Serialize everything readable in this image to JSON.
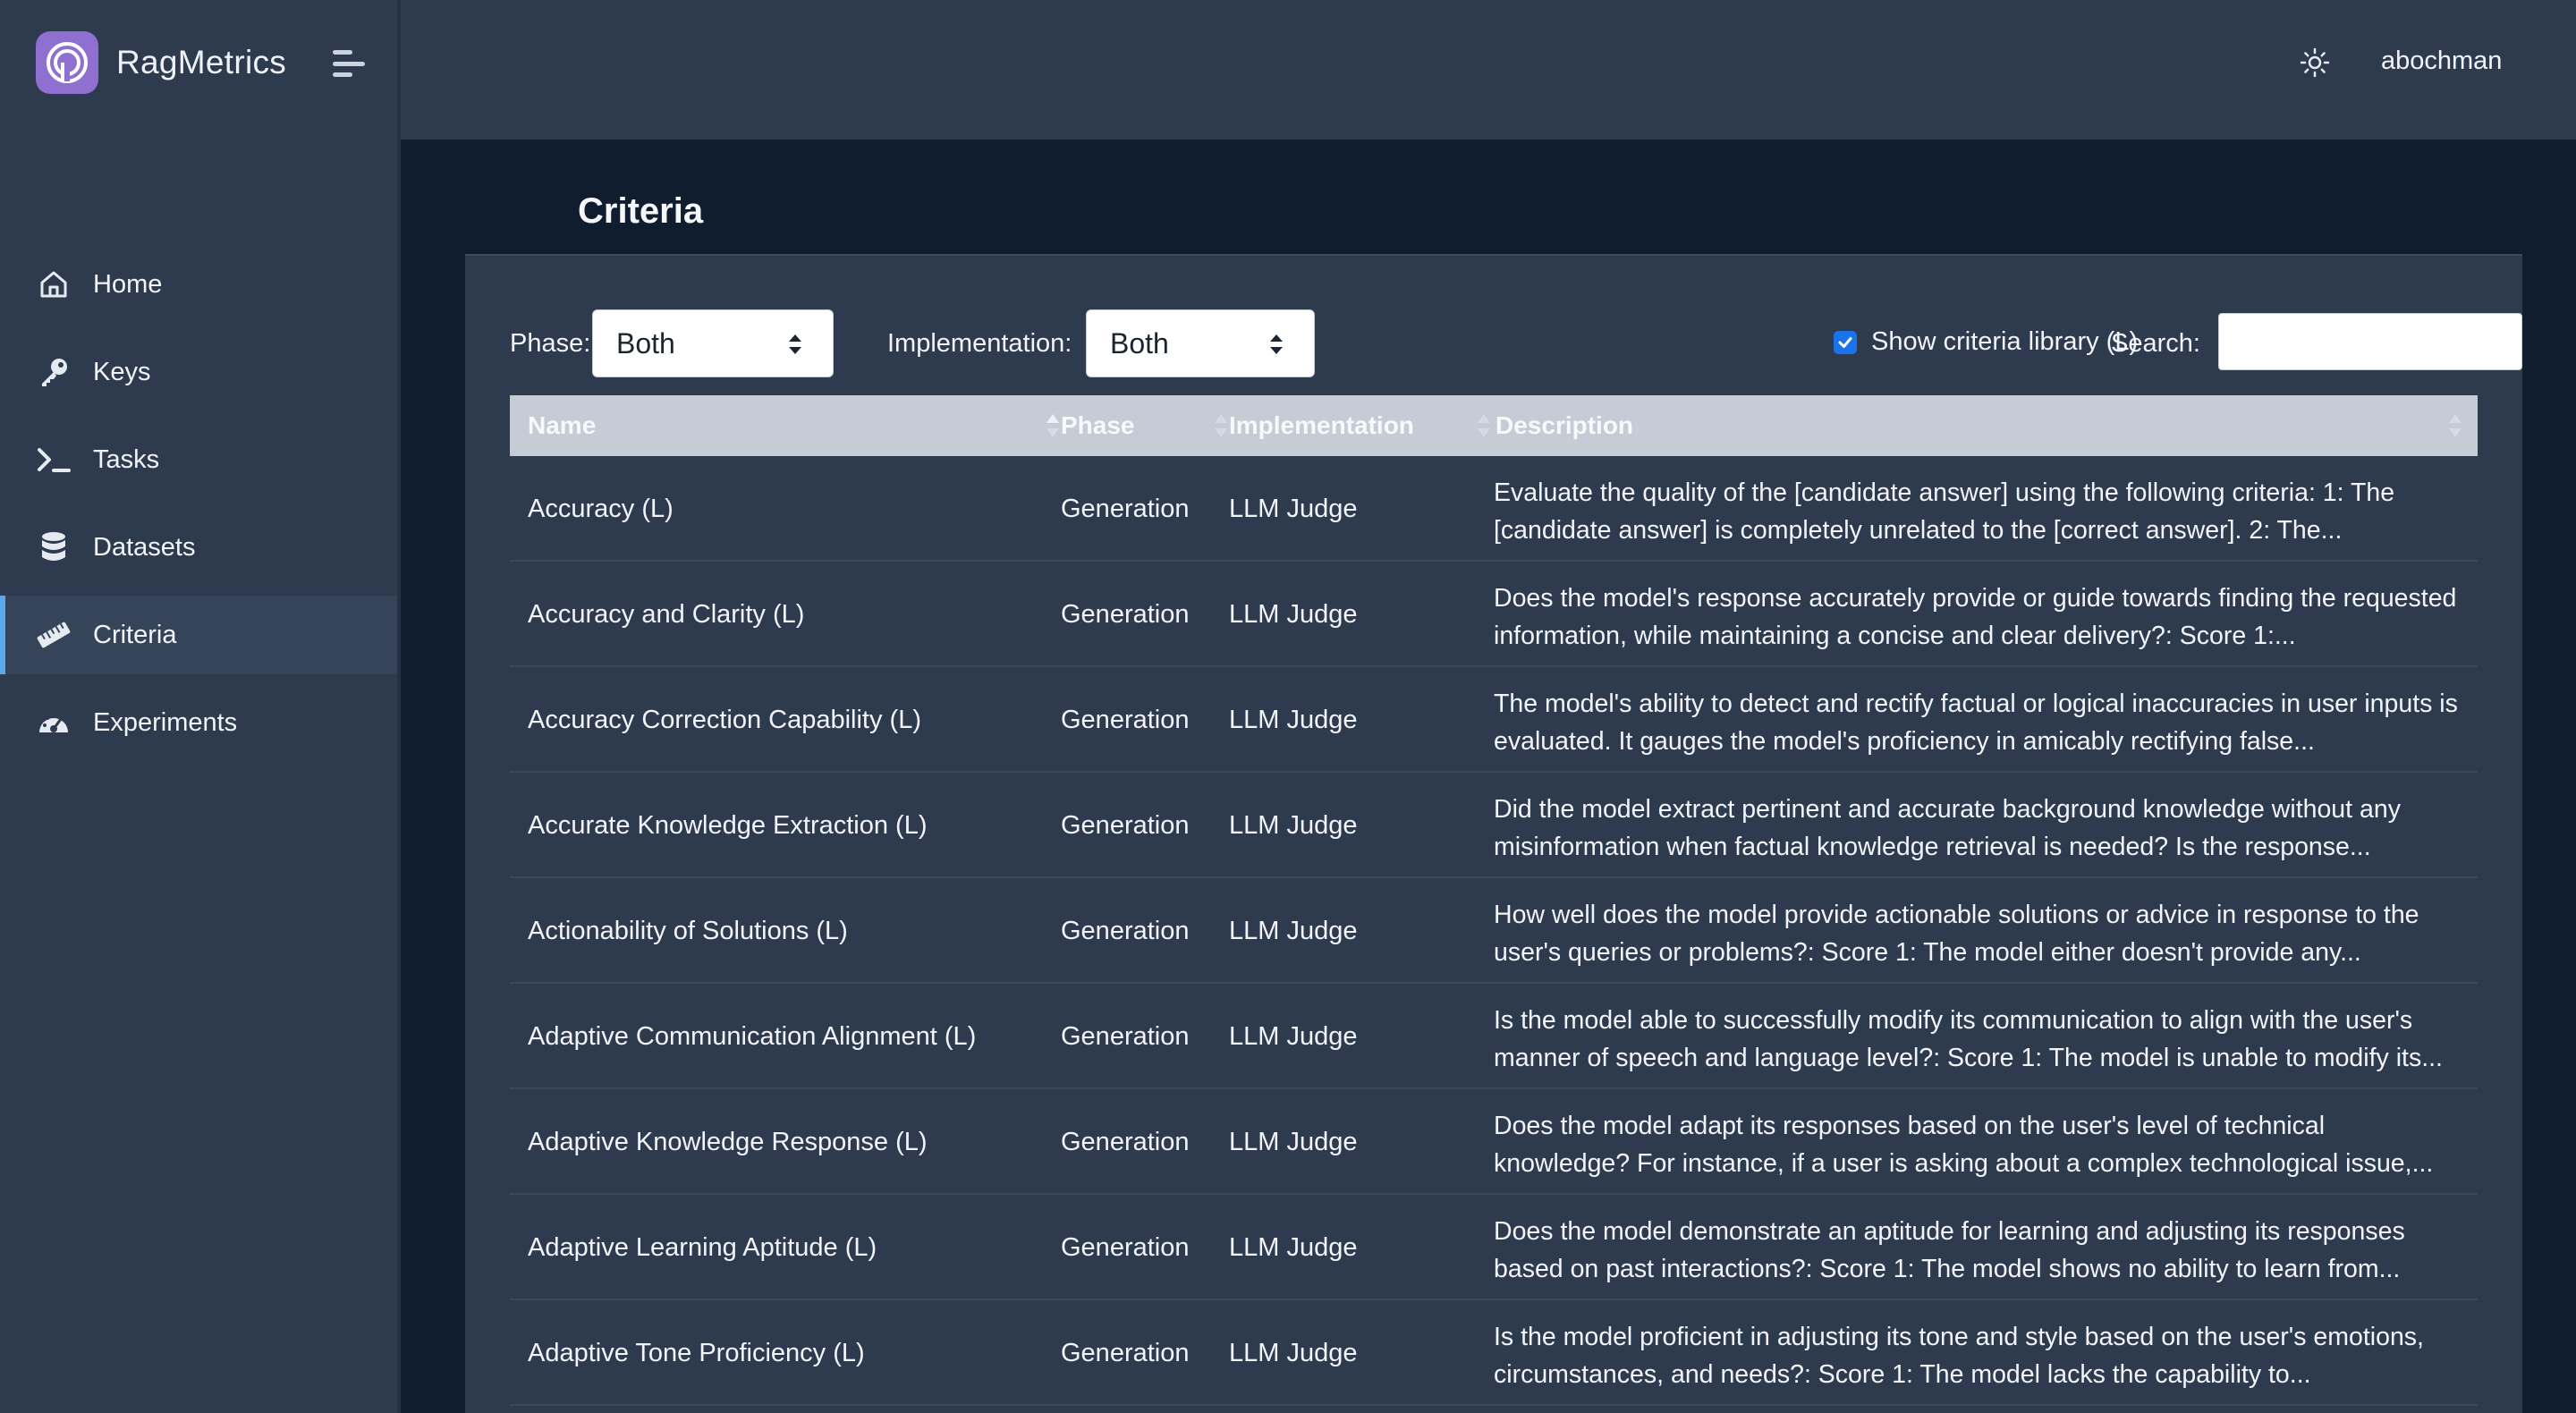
{
  "app": {
    "brand": "RagMetrics"
  },
  "header": {
    "username": "abochman"
  },
  "sidebar": {
    "items": [
      {
        "label": "Home",
        "icon": "home-icon",
        "active": false
      },
      {
        "label": "Keys",
        "icon": "key-icon",
        "active": false
      },
      {
        "label": "Tasks",
        "icon": "terminal-icon",
        "active": false
      },
      {
        "label": "Datasets",
        "icon": "database-icon",
        "active": false
      },
      {
        "label": "Criteria",
        "icon": "ruler-icon",
        "active": true
      },
      {
        "label": "Experiments",
        "icon": "gauge-icon",
        "active": false
      }
    ]
  },
  "page": {
    "title": "Criteria"
  },
  "filters": {
    "phase_label": "Phase:",
    "phase_value": "Both",
    "implementation_label": "Implementation:",
    "implementation_value": "Both",
    "library_label": "Show criteria library (L)",
    "library_checked": true,
    "search_label": "Search:",
    "search_value": ""
  },
  "table": {
    "columns": [
      "Name",
      "Phase",
      "Implementation",
      "Description"
    ],
    "rows": [
      {
        "name": "Accuracy (L)",
        "phase": "Generation",
        "implementation": "LLM Judge",
        "description": "Evaluate the quality of the [candidate answer] using the following criteria: 1: The [candidate answer] is completely unrelated to the [correct answer]. 2: The..."
      },
      {
        "name": "Accuracy and Clarity (L)",
        "phase": "Generation",
        "implementation": "LLM Judge",
        "description": "Does the model's response accurately provide or guide towards finding the requested information, while maintaining a concise and clear delivery?: Score 1:..."
      },
      {
        "name": "Accuracy Correction Capability (L)",
        "phase": "Generation",
        "implementation": "LLM Judge",
        "description": "The model's ability to detect and rectify factual or logical inaccuracies in user inputs is evaluated. It gauges the model's proficiency in amicably rectifying false..."
      },
      {
        "name": "Accurate Knowledge Extraction (L)",
        "phase": "Generation",
        "implementation": "LLM Judge",
        "description": "Did the model extract pertinent and accurate background knowledge without any misinformation when factual knowledge retrieval is needed? Is the response..."
      },
      {
        "name": "Actionability of Solutions (L)",
        "phase": "Generation",
        "implementation": "LLM Judge",
        "description": "How well does the model provide actionable solutions or advice in response to the user's queries or problems?: Score 1: The model either doesn't provide any..."
      },
      {
        "name": "Adaptive Communication Alignment (L)",
        "phase": "Generation",
        "implementation": "LLM Judge",
        "description": "Is the model able to successfully modify its communication to align with the user's manner of speech and language level?: Score 1: The model is unable to modify its..."
      },
      {
        "name": "Adaptive Knowledge Response (L)",
        "phase": "Generation",
        "implementation": "LLM Judge",
        "description": "Does the model adapt its responses based on the user's level of technical knowledge? For instance, if a user is asking about a complex technological issue,..."
      },
      {
        "name": "Adaptive Learning Aptitude (L)",
        "phase": "Generation",
        "implementation": "LLM Judge",
        "description": "Does the model demonstrate an aptitude for learning and adjusting its responses based on past interactions?: Score 1: The model shows no ability to learn from..."
      },
      {
        "name": "Adaptive Tone Proficiency (L)",
        "phase": "Generation",
        "implementation": "LLM Judge",
        "description": "Is the model proficient in adjusting its tone and style based on the user's emotions, circumstances, and needs?: Score 1: The model lacks the capability to..."
      }
    ]
  }
}
